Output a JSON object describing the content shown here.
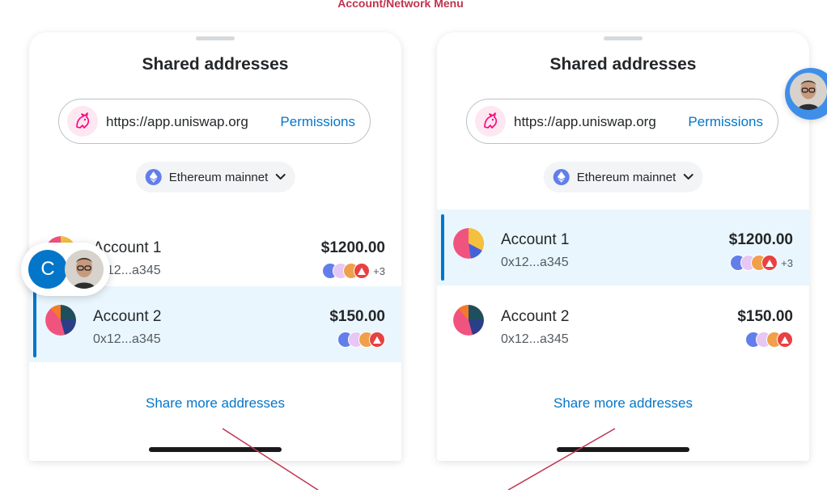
{
  "header": {
    "label": "Account/Network Menu"
  },
  "panels": [
    {
      "title": "Shared addresses",
      "site": {
        "url": "https://app.uniswap.org",
        "permissions_label": "Permissions",
        "logo_icon": "uniswap-unicorn-icon"
      },
      "network": {
        "name": "Ethereum mainnet",
        "icon": "ethereum-icon"
      },
      "accounts": [
        {
          "name": "Account 1",
          "address": "0x12...a345",
          "balance": "$1200.00",
          "tokens_more": "+3",
          "selected": false
        },
        {
          "name": "Account 2",
          "address": "0x12...a345",
          "balance": "$150.00",
          "tokens_more": "",
          "selected": true
        }
      ],
      "share_more_label": "Share more addresses",
      "connected_bubble": {
        "initial": "C"
      }
    },
    {
      "title": "Shared addresses",
      "site": {
        "url": "https://app.uniswap.org",
        "permissions_label": "Permissions",
        "logo_icon": "uniswap-unicorn-icon"
      },
      "network": {
        "name": "Ethereum mainnet",
        "icon": "ethereum-icon"
      },
      "accounts": [
        {
          "name": "Account 1",
          "address": "0x12...a345",
          "balance": "$1200.00",
          "tokens_more": "+3",
          "selected": true
        },
        {
          "name": "Account 2",
          "address": "0x12...a345",
          "balance": "$150.00",
          "tokens_more": "",
          "selected": false
        }
      ],
      "share_more_label": "Share more addresses"
    }
  ],
  "colors": {
    "accent": "#0376c9",
    "header_label": "#c0334f",
    "selected_row": "#eaf6fd",
    "annotation_line": "#c0334f"
  }
}
